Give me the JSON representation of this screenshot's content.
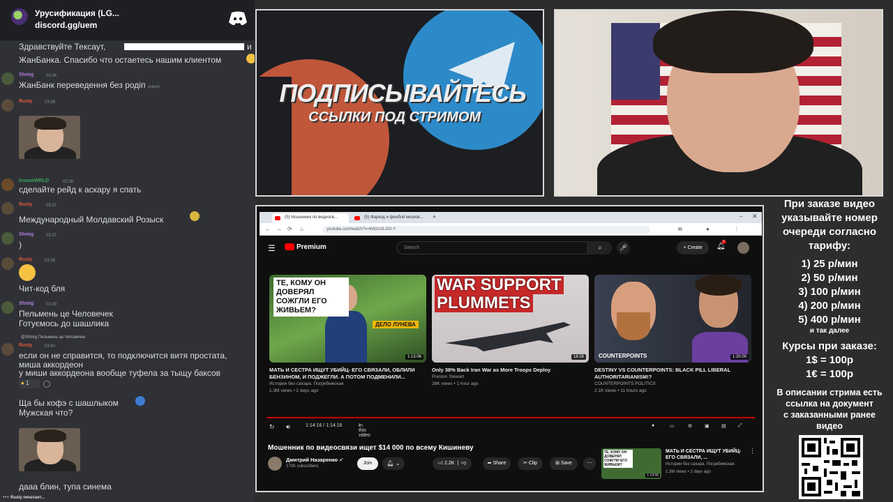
{
  "discord": {
    "server_title": "Урусификация (LG...",
    "invite_link": "discord.gg/uem"
  },
  "chat": {
    "line_1": "Здравствуйте Тексаут,",
    "line_1_end": "и",
    "line_2": "ЖанБанка. Спасибо что остаетесь нашим клиентом",
    "m1_user": "Shmig",
    "m1_time": "03:36",
    "m1_text": "ЖанБанк переведення без родiп",
    "m1_edited": "(edited)",
    "m2_user": "Rusty",
    "m2_time": "03:36",
    "m3_user": "InsaneWRLD",
    "m3_time": "03:36",
    "m3_text": "сделайте рейд к аскару я спать",
    "m4_user": "Rusty",
    "m4_time": "03:37",
    "m4_text": "Международный Молдавский Розыск",
    "m5_user": "Shmig",
    "m5_time": "03:37",
    "m5_text": ")",
    "m6_user": "Rusty",
    "m6_time": "03:38",
    "m6_text": "Чит-код бля",
    "m7_user": "Shmig",
    "m7_time": "03:39",
    "m7_text_1": "Пельмень це Человечек",
    "m7_text_2": "Готуємось до шашлика",
    "m8_reply": "@Shmig Пельмень це Человечек",
    "m8_user": "Rusty",
    "m8_time": "03:40",
    "m8_text_1": "если он не справится, то подключится витя простата,",
    "m8_text_2": "миша аккордеон",
    "m8_text_3": "у миши аккордеона вообще туфела за тыщу баксов",
    "m8_reaction": "1",
    "m9_text_1": "Ща бы кофэ с шашлыком",
    "m9_text_2": "Мужская что?",
    "m10_text": "дааа блин, тупа синема",
    "typing": "Rusty печатает..."
  },
  "promo": {
    "headline": "ПОДПИСЫВАЙТЕСЬ",
    "subline": "ССЫЛКИ ПОД СТРИМОМ"
  },
  "browser": {
    "tab_1": "(5) Мошенник по видеосв...",
    "tab_2": "(5) Фарход и фенбой москов...",
    "url": "youtube.com/watch?v=lhNzUvLGG-Y"
  },
  "youtube": {
    "logo_text": "Premium",
    "search_placeholder": "Search",
    "create_label": "Create",
    "notif_count": "9",
    "videos": [
      {
        "thumb_text": "ТЕ, КОМУ ОН ДОВЕРЯЛ СОЖГЛИ ЕГО ЖИВЬЕМ?",
        "tag": "ДЕЛО ЛУНЕВА",
        "duration": "1:13:06",
        "title": "МАТЬ И СЕСТРА ИЩУТ УБИЙЦ- ЕГО СВЯЗАЛИ, ОБЛИЛИ БЕНЗИНОМ, И ПОДЖЕГЛИ. А ПОТОМ ПОДМЕНИЛИ...",
        "channel": "Истории без сахара. Погребижская.",
        "meta": "1.3M views • 2 days ago"
      },
      {
        "thumb_text_1": "WAR SUPPORT",
        "thumb_text_2": "PLUMMETS",
        "duration": "18:26",
        "title": "Only 38% Back Iran War as More Troops Deploy",
        "channel": "Preston Stewart",
        "meta": "26K views • 1 hour ago"
      },
      {
        "thumb_text": "COUNTERPOINTS",
        "duration": "1:20:00",
        "title": "DESTINY VS COUNTERPOINTS: BLACK PILL LIBERAL AUTHORITARIANISM!?",
        "channel": "COUNTERPOINTS POLITICS",
        "meta": "2.1K views • 11 hours ago"
      }
    ],
    "player_time": "1:14:16 / 1:14:16",
    "in_this_video": "In this video",
    "video_title": "Мошенник по видеосвязи ищет $14 000 по всему Кишиневу",
    "channel_name": "Дмитрий Назаренко",
    "subscribers": "170K subscribers",
    "join_label": "Join",
    "likes": "2.2K",
    "share_label": "Share",
    "clip_label": "Clip",
    "save_label": "Save",
    "side_thumb_text": "ТЕ, КОМУ ОН ДОВЕРЯЛ СОЖГЛИ ЕГО ЖИВЬЕМ?",
    "side_title": "МАТЬ И СЕСТРА ИЩУТ УБИЙЦ- ЕГО СВЯЗАЛИ, ...",
    "side_channel": "Истории без сахара. Погребижская.",
    "side_meta": "1.3M views • 2 days ago",
    "side_duration": "1:13:06"
  },
  "info": {
    "order_1": "При заказе видео",
    "order_2": "указывайте номер",
    "order_3": "очереди согласно",
    "order_4": "тарифу:",
    "tariff_1": "1) 25 р/мин",
    "tariff_2": "2) 50 р/мин",
    "tariff_3": "3) 100 р/мин",
    "tariff_4": "4) 200 р/мин",
    "tariff_5": "5) 400 р/мин",
    "etc": "и так далее",
    "rates_title_1": "Курсы при заказе:",
    "rate_usd": "1$ = 100р",
    "rate_eur": "1€ = 100р",
    "desc_1": "В описании стрима есть",
    "desc_2": "ссылка на документ",
    "desc_3": "с заказанными ранее",
    "desc_4": "видео"
  },
  "colors": {
    "shmig": "#b07ddb",
    "rusty": "#e0583b",
    "insane": "#3ba55d",
    "youtube_red": "#ff0000"
  }
}
